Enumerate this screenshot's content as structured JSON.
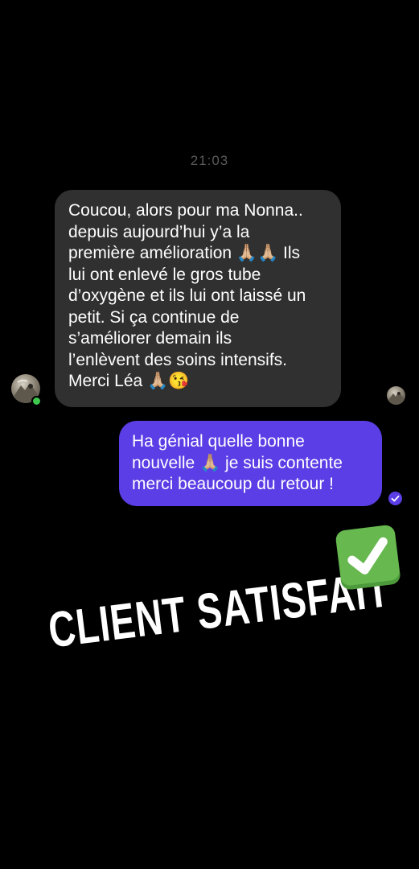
{
  "chat": {
    "timestamp": "21:03",
    "messages": [
      {
        "direction": "incoming",
        "text": "Coucou, alors pour ma Nonna..\ndepuis aujourd’hui y’a la\npremière amélioration 🙏🏼🙏🏼 Ils\nlui ont enlevé le gros tube\nd’oxygène et ils lui ont laissé un\npetit. Si ça continue de\ns’améliorer demain ils\nl’enlèvent des soins intensifs.\nMerci Léa 🙏🏼😘"
      },
      {
        "direction": "outgoing",
        "text": "Ha génial quelle bonne\nnouvelle 🙏🏼 je suis contente\nmerci beaucoup du retour !"
      }
    ],
    "contact_status": "online",
    "read_status": "seen"
  },
  "overlay": {
    "sticker_text": "CLIENT SATISFAIT",
    "sticker_emoji": "white-check-mark-icon"
  },
  "colors": {
    "background": "#000000",
    "incoming_bubble": "#303030",
    "outgoing_bubble": "#5b3ee6",
    "online_dot": "#3ec74d",
    "check_green": "#66b84f"
  }
}
